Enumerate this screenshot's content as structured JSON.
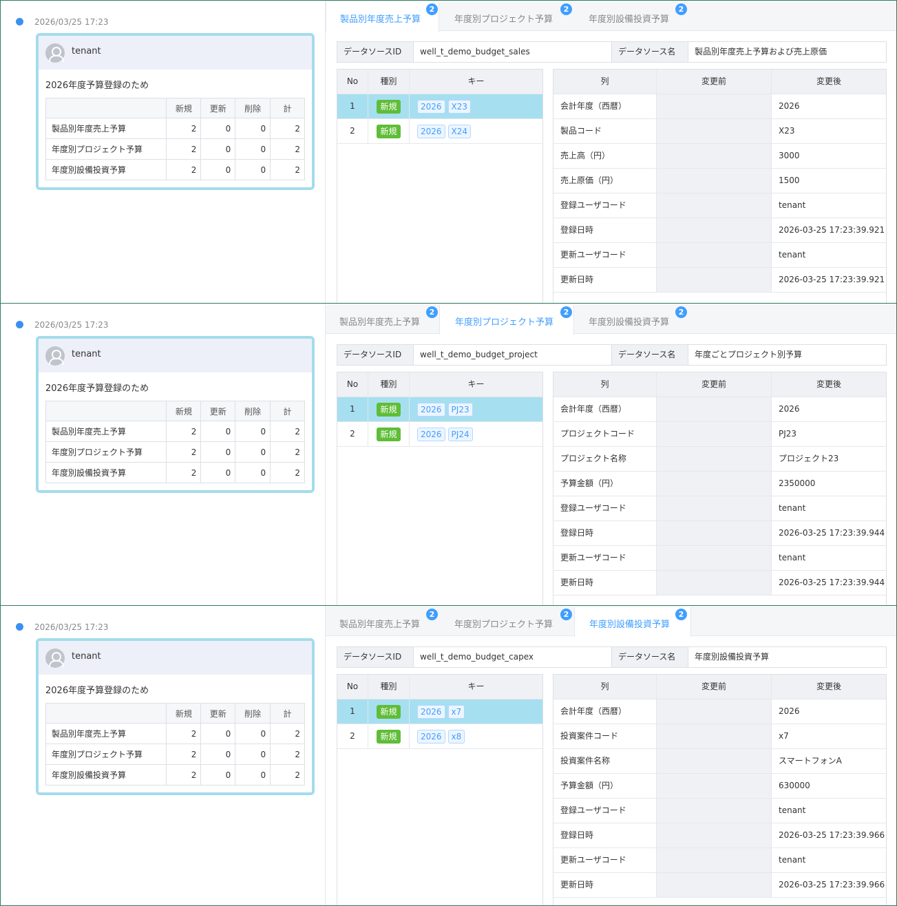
{
  "panels": [
    {
      "timestamp": "2026/03/25 17:23",
      "user": "tenant",
      "card_title": "2026年度予算登録のため",
      "summary": {
        "headers": [
          "",
          "新規",
          "更新",
          "削除",
          "計"
        ],
        "rows": [
          {
            "label": "製品別年度売上予算",
            "new": "2",
            "update": "0",
            "delete": "0",
            "total": "2"
          },
          {
            "label": "年度別プロジェクト予算",
            "new": "2",
            "update": "0",
            "delete": "0",
            "total": "2"
          },
          {
            "label": "年度別設備投資予算",
            "new": "2",
            "update": "0",
            "delete": "0",
            "total": "2"
          }
        ]
      },
      "tabs": [
        {
          "label": "製品別年度売上予算",
          "badge": "2",
          "active": true
        },
        {
          "label": "年度別プロジェクト予算",
          "badge": "2",
          "active": false
        },
        {
          "label": "年度別設備投資予算",
          "badge": "2",
          "active": false
        }
      ],
      "datasource": {
        "id_label": "データソースID",
        "id": "well_t_demo_budget_sales",
        "name_label": "データソース名",
        "name": "製品別年度売上予算および売上原価"
      },
      "key_table": {
        "headers": {
          "no": "No",
          "kind": "種別",
          "key": "キー"
        },
        "rows": [
          {
            "no": "1",
            "kind": "新規",
            "keys": [
              "2026",
              "X23"
            ],
            "selected": true
          },
          {
            "no": "2",
            "kind": "新規",
            "keys": [
              "2026",
              "X24"
            ],
            "selected": false
          }
        ]
      },
      "detail_table": {
        "headers": {
          "col": "列",
          "before": "変更前",
          "after": "変更後"
        },
        "rows": [
          {
            "col": "会計年度（西暦）",
            "before": "",
            "after": "2026"
          },
          {
            "col": "製品コード",
            "before": "",
            "after": "X23"
          },
          {
            "col": "売上高（円）",
            "before": "",
            "after": "3000"
          },
          {
            "col": "売上原価（円）",
            "before": "",
            "after": "1500"
          },
          {
            "col": "登録ユーザコード",
            "before": "",
            "after": "tenant"
          },
          {
            "col": "登録日時",
            "before": "",
            "after": "2026-03-25 17:23:39.921"
          },
          {
            "col": "更新ユーザコード",
            "before": "",
            "after": "tenant"
          },
          {
            "col": "更新日時",
            "before": "",
            "after": "2026-03-25 17:23:39.921"
          }
        ]
      }
    },
    {
      "timestamp": "2026/03/25 17:23",
      "user": "tenant",
      "card_title": "2026年度予算登録のため",
      "summary": {
        "headers": [
          "",
          "新規",
          "更新",
          "削除",
          "計"
        ],
        "rows": [
          {
            "label": "製品別年度売上予算",
            "new": "2",
            "update": "0",
            "delete": "0",
            "total": "2"
          },
          {
            "label": "年度別プロジェクト予算",
            "new": "2",
            "update": "0",
            "delete": "0",
            "total": "2"
          },
          {
            "label": "年度別設備投資予算",
            "new": "2",
            "update": "0",
            "delete": "0",
            "total": "2"
          }
        ]
      },
      "tabs": [
        {
          "label": "製品別年度売上予算",
          "badge": "2",
          "active": false
        },
        {
          "label": "年度別プロジェクト予算",
          "badge": "2",
          "active": true
        },
        {
          "label": "年度別設備投資予算",
          "badge": "2",
          "active": false
        }
      ],
      "datasource": {
        "id_label": "データソースID",
        "id": "well_t_demo_budget_project",
        "name_label": "データソース名",
        "name": "年度ごとプロジェクト別予算"
      },
      "key_table": {
        "headers": {
          "no": "No",
          "kind": "種別",
          "key": "キー"
        },
        "rows": [
          {
            "no": "1",
            "kind": "新規",
            "keys": [
              "2026",
              "PJ23"
            ],
            "selected": true
          },
          {
            "no": "2",
            "kind": "新規",
            "keys": [
              "2026",
              "PJ24"
            ],
            "selected": false
          }
        ]
      },
      "detail_table": {
        "headers": {
          "col": "列",
          "before": "変更前",
          "after": "変更後"
        },
        "rows": [
          {
            "col": "会計年度（西暦）",
            "before": "",
            "after": "2026"
          },
          {
            "col": "プロジェクトコード",
            "before": "",
            "after": "PJ23"
          },
          {
            "col": "プロジェクト名称",
            "before": "",
            "after": "プロジェクト23"
          },
          {
            "col": "予算金額（円）",
            "before": "",
            "after": "2350000"
          },
          {
            "col": "登録ユーザコード",
            "before": "",
            "after": "tenant"
          },
          {
            "col": "登録日時",
            "before": "",
            "after": "2026-03-25 17:23:39.944"
          },
          {
            "col": "更新ユーザコード",
            "before": "",
            "after": "tenant"
          },
          {
            "col": "更新日時",
            "before": "",
            "after": "2026-03-25 17:23:39.944"
          }
        ]
      }
    },
    {
      "timestamp": "2026/03/25 17:23",
      "user": "tenant",
      "card_title": "2026年度予算登録のため",
      "summary": {
        "headers": [
          "",
          "新規",
          "更新",
          "削除",
          "計"
        ],
        "rows": [
          {
            "label": "製品別年度売上予算",
            "new": "2",
            "update": "0",
            "delete": "0",
            "total": "2"
          },
          {
            "label": "年度別プロジェクト予算",
            "new": "2",
            "update": "0",
            "delete": "0",
            "total": "2"
          },
          {
            "label": "年度別設備投資予算",
            "new": "2",
            "update": "0",
            "delete": "0",
            "total": "2"
          }
        ]
      },
      "tabs": [
        {
          "label": "製品別年度売上予算",
          "badge": "2",
          "active": false
        },
        {
          "label": "年度別プロジェクト予算",
          "badge": "2",
          "active": false
        },
        {
          "label": "年度別設備投資予算",
          "badge": "2",
          "active": true
        }
      ],
      "datasource": {
        "id_label": "データソースID",
        "id": "well_t_demo_budget_capex",
        "name_label": "データソース名",
        "name": "年度別設備投資予算"
      },
      "key_table": {
        "headers": {
          "no": "No",
          "kind": "種別",
          "key": "キー"
        },
        "rows": [
          {
            "no": "1",
            "kind": "新規",
            "keys": [
              "2026",
              "x7"
            ],
            "selected": true
          },
          {
            "no": "2",
            "kind": "新規",
            "keys": [
              "2026",
              "x8"
            ],
            "selected": false
          }
        ]
      },
      "detail_table": {
        "headers": {
          "col": "列",
          "before": "変更前",
          "after": "変更後"
        },
        "rows": [
          {
            "col": "会計年度（西暦）",
            "before": "",
            "after": "2026"
          },
          {
            "col": "投資案件コード",
            "before": "",
            "after": "x7"
          },
          {
            "col": "投資案件名称",
            "before": "",
            "after": "スマートフォンA"
          },
          {
            "col": "予算金額（円）",
            "before": "",
            "after": "630000"
          },
          {
            "col": "登録ユーザコード",
            "before": "",
            "after": "tenant"
          },
          {
            "col": "登録日時",
            "before": "",
            "after": "2026-03-25 17:23:39.966"
          },
          {
            "col": "更新ユーザコード",
            "before": "",
            "after": "tenant"
          },
          {
            "col": "更新日時",
            "before": "",
            "after": "2026-03-25 17:23:39.966"
          }
        ]
      }
    }
  ]
}
